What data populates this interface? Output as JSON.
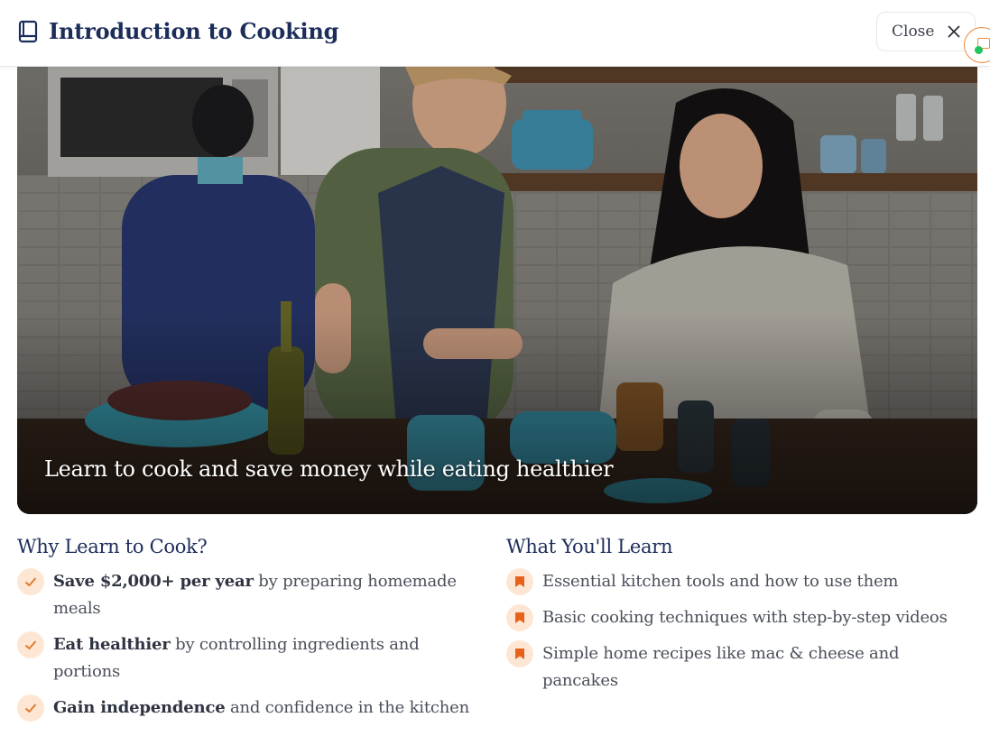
{
  "header": {
    "title": "Introduction to Cooking",
    "close_label": "Close",
    "icon": "book-icon"
  },
  "hero": {
    "image_description_icon": "kitchen-photo",
    "caption": "Learn to cook and save money while eating healthier"
  },
  "why": {
    "heading": "Why Learn to Cook?",
    "items": [
      {
        "bold": "Save $2,000+ per year",
        "rest": " by preparing homemade meals"
      },
      {
        "bold": "Eat healthier",
        "rest": " by controlling ingredients and portions"
      },
      {
        "bold": "Gain independence",
        "rest": " and confidence in the kitchen"
      }
    ]
  },
  "learn": {
    "heading": "What You'll Learn",
    "items": [
      "Essential kitchen tools and how to use them",
      "Basic cooking techniques with step-by-step videos",
      "Simple home recipes like mac & cheese and pancakes"
    ]
  },
  "colors": {
    "title": "#1c2d5a",
    "accent": "#f0883e",
    "bullet_bg": "#fde7d4",
    "status_dot": "#22c55e"
  }
}
